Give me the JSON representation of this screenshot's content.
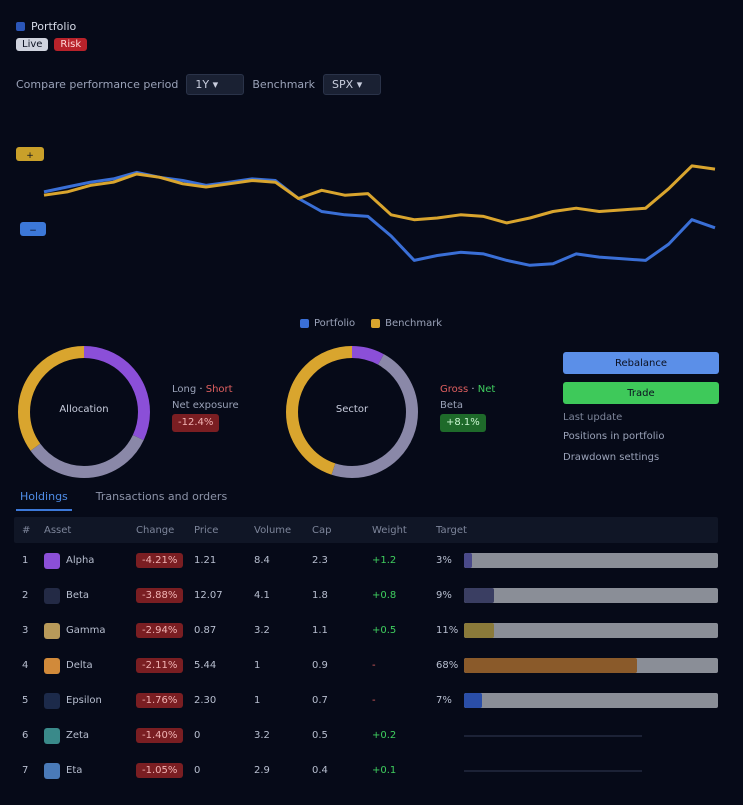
{
  "header": {
    "line1_label": "Portfolio",
    "line2_label": "Live",
    "line2_badge": "Risk"
  },
  "filters": {
    "compare_label": "Compare performance period",
    "period_value": "1Y",
    "benchmark_label": "Benchmark",
    "benchmark_value": "SPX"
  },
  "chart_data": {
    "type": "line",
    "title": "",
    "y_badge_top": "+",
    "y_badge_bottom": "−",
    "x_ticks": [
      "",
      "",
      "",
      "",
      "",
      "",
      "",
      "",
      "",
      "",
      "",
      "",
      "",
      "",
      "",
      ""
    ],
    "series": [
      {
        "name": "Portfolio",
        "color": "#3a6fd6",
        "values": [
          62,
          65,
          68,
          70,
          74,
          71,
          69,
          66,
          68,
          70,
          69,
          58,
          50,
          48,
          47,
          35,
          20,
          23,
          25,
          24,
          20,
          17,
          18,
          24,
          22,
          21,
          20,
          30,
          45,
          40
        ]
      },
      {
        "name": "Benchmark",
        "color": "#d9a52e",
        "values": [
          60,
          62,
          66,
          68,
          73,
          71,
          67,
          65,
          67,
          69,
          68,
          58,
          63,
          60,
          61,
          48,
          45,
          46,
          48,
          47,
          43,
          46,
          50,
          52,
          50,
          51,
          52,
          64,
          78,
          76
        ]
      }
    ],
    "ylim": [
      0,
      100
    ],
    "grid": false,
    "legend": "bottom"
  },
  "legend": {
    "a": "Portfolio",
    "b": "Benchmark"
  },
  "donuts": [
    {
      "center_label": "Allocation",
      "stat1": "Long",
      "stat1b": "Short",
      "stat2": "Net exposure",
      "stat2_value": "-12.4%",
      "segments": [
        {
          "color": "#8b4fd8",
          "value": 0.32
        },
        {
          "color": "#8a88a8",
          "value": 0.33
        },
        {
          "color": "#d9a52e",
          "value": 0.35
        }
      ]
    },
    {
      "center_label": "Sector",
      "stat1": "Gross",
      "stat1b": "Net",
      "stat2": "Beta",
      "stat2_value": "+8.1%",
      "segments": [
        {
          "color": "#8b4fd8",
          "value": 0.08
        },
        {
          "color": "#8a88a8",
          "value": 0.47
        },
        {
          "color": "#d9a52e",
          "value": 0.45
        }
      ]
    }
  ],
  "actions": {
    "primary": "Rebalance",
    "secondary": "Trade",
    "info1": "Last update",
    "info2": "Positions in portfolio",
    "info3": "Drawdown settings"
  },
  "tabs": [
    {
      "label": "Holdings"
    },
    {
      "label": "Transactions and orders"
    }
  ],
  "table": {
    "columns": [
      "#",
      "Asset",
      "Change",
      "Price",
      "Volume",
      "Cap",
      "Weight",
      "Target"
    ],
    "rows": [
      {
        "idx": "1",
        "name": "Alpha",
        "change": "-4.21%",
        "price": "1.21",
        "vol": "8.4",
        "cap": "2.3",
        "weight": "+1.2",
        "t": "3%",
        "color": "#8b4fd8",
        "fill": 0.03,
        "fill_color": "#4a4a8a",
        "wc": "#2e8a3e"
      },
      {
        "idx": "2",
        "name": "Beta",
        "change": "-3.88%",
        "price": "12.07",
        "vol": "4.1",
        "cap": "1.8",
        "weight": "+0.8",
        "t": "9%",
        "color": "#232a45",
        "fill": 0.12,
        "fill_color": "#3a3e62",
        "wc": "#2e8a3e"
      },
      {
        "idx": "3",
        "name": "Gamma",
        "change": "-2.94%",
        "price": "0.87",
        "vol": "3.2",
        "cap": "1.1",
        "weight": "+0.5",
        "t": "11%",
        "color": "#b89a5a",
        "fill": 0.12,
        "fill_color": "#8a7a3a",
        "wc": "#2e8a3e"
      },
      {
        "idx": "4",
        "name": "Delta",
        "change": "-2.11%",
        "price": "5.44",
        "vol": "1",
        "cap": "0.9",
        "weight": "-",
        "t": "68%",
        "color": "#d18a3a",
        "fill": 0.68,
        "fill_color": "#8a5a2a",
        "wc": "#8a2a2a"
      },
      {
        "idx": "5",
        "name": "Epsilon",
        "change": "-1.76%",
        "price": "2.30",
        "vol": "1",
        "cap": "0.7",
        "weight": "-",
        "t": "7%",
        "color": "#1c2a4a",
        "fill": 0.07,
        "fill_color": "#2a4ea8",
        "wc": "#8a2a2a"
      },
      {
        "idx": "6",
        "name": "Zeta",
        "change": "-1.40%",
        "price": "0",
        "vol": "3.2",
        "cap": "0.5",
        "weight": "+0.2",
        "t": "",
        "color": "#3a8a8a",
        "fill": 0,
        "fill_color": "#444",
        "wc": "#2e8a3e"
      },
      {
        "idx": "7",
        "name": "Eta",
        "change": "-1.05%",
        "price": "0",
        "vol": "2.9",
        "cap": "0.4",
        "weight": "+0.1",
        "t": "",
        "color": "#4a7ab8",
        "fill": 0,
        "fill_color": "#444",
        "wc": "#2e8a3e"
      }
    ]
  },
  "colors": {
    "accent": "#3c78d8",
    "positive": "#2fbf4f",
    "negative": "#c0392b",
    "gold": "#d9a52e",
    "purple": "#8b4fd8"
  }
}
